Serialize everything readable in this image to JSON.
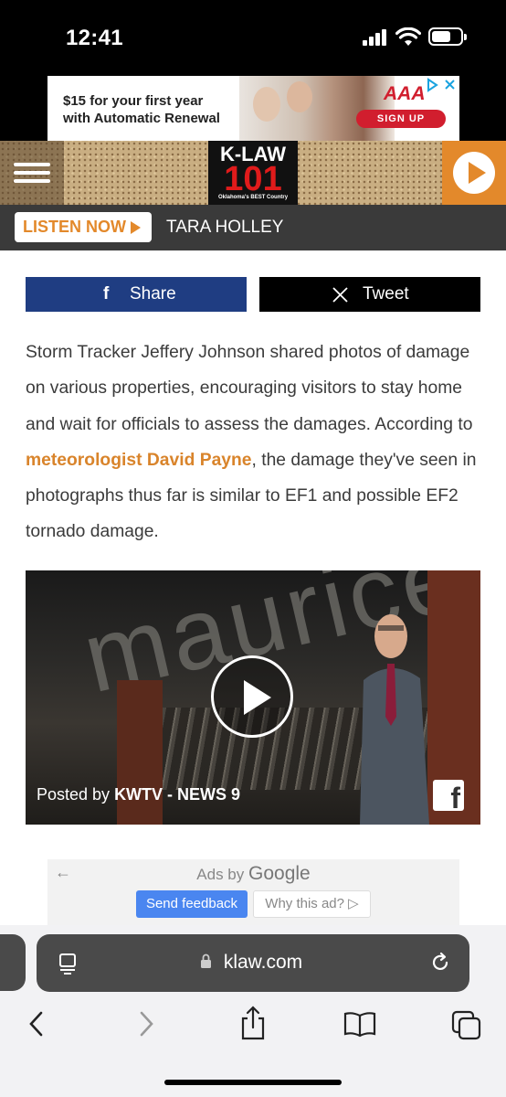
{
  "status": {
    "time": "12:41"
  },
  "ad_top": {
    "line1": "$15 for your first year",
    "line2": "with Automatic Renewal",
    "brand": "AAA",
    "cta": "SIGN UP"
  },
  "header": {
    "logo_top": "K-LAW",
    "logo_num": "101",
    "logo_tag": "Oklahoma's BEST Country"
  },
  "listen": {
    "button": "LISTEN NOW",
    "dj": "TARA HOLLEY"
  },
  "social": {
    "share": "Share",
    "tweet": "Tweet"
  },
  "article": {
    "text_before": "Storm Tracker Jeffery Johnson shared photos of damage on various properties, encouraging visitors to stay home and wait for officials to assess the damages. According to ",
    "link": "meteorologist David Payne",
    "text_after": ", the damage they've seen in photographs thus far is similar to EF1 and possible EF2 tornado damage."
  },
  "video": {
    "sign_text": "maurices",
    "posted_prefix": "Posted by ",
    "posted_by": "KWTV - NEWS 9"
  },
  "google_ad": {
    "ads_by": "Ads by",
    "google": "Google",
    "feedback": "Send feedback",
    "why": "Why this ad? ▷"
  },
  "browser": {
    "url": "klaw.com"
  },
  "colors": {
    "accent": "#e3892b",
    "facebook": "#1f3d82",
    "link": "#d9842b"
  }
}
